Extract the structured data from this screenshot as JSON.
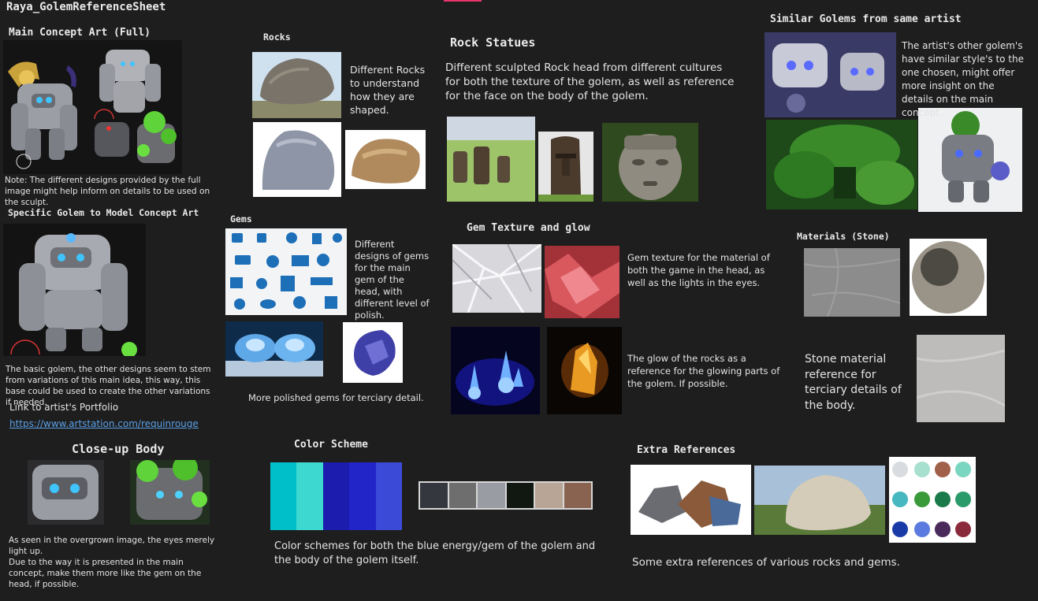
{
  "board_title": "Raya_GolemReferenceSheet",
  "main_concept": {
    "title": "Main Concept Art (Full)",
    "note": "Note: The different designs provided by the full image might help inform on details to be used on the sculpt."
  },
  "specific_golem": {
    "title": "Specific Golem to Model Concept Art",
    "desc": "The basic golem, the other designs seem to stem from variations of this main idea, this way, this base could be used to create the other variations if needed.",
    "link_label": "Link to artist's Portfolio",
    "link_url": "https://www.artstation.com/requinrouge"
  },
  "closeup": {
    "title": "Close-up Body",
    "desc": "As seen in the overgrown image, the eyes merely light up.\nDue to the way it is presented in the main concept, make them more like the gem on the head, if possible."
  },
  "rocks": {
    "title": "Rocks",
    "desc": "Different Rocks to understand how they are shaped."
  },
  "gems": {
    "title": "Gems",
    "desc": "Different designs of gems for the main gem of the head, with different level of polish.",
    "desc2": "More polished gems for terciary detail."
  },
  "rock_statues": {
    "title": "Rock Statues",
    "desc": "Different sculpted Rock head from different cultures for both the texture of the golem, as well as reference for the face on the body of the golem."
  },
  "gem_texture": {
    "title": "Gem Texture and glow",
    "desc": "Gem texture for the material of both the game in the head, as well as the lights in the eyes.",
    "desc2": "The glow of the rocks as a reference for the glowing parts of the golem. If possible."
  },
  "similar": {
    "title": "Similar Golems from same artist",
    "desc": "The artist's other golem's have similar style's to the one chosen, might offer more insight on the details on the main concept."
  },
  "materials": {
    "title": "Materials (Stone)",
    "desc": "Stone material reference for terciary details of the body."
  },
  "color_scheme": {
    "title": "Color Scheme",
    "desc": "Color schemes for both the blue energy/gem of the golem and the body of the golem itself.",
    "blue_palette": [
      "#00bfc9",
      "#3dd9d0",
      "#1c1caf",
      "#2226c8",
      "#3c4ad8"
    ],
    "body_palette": [
      "#34373e",
      "#6e6e6e",
      "#9a9ca4",
      "#111811",
      "#b8a596",
      "#8a6250"
    ]
  },
  "extra": {
    "title": "Extra References",
    "desc": "Some extra references of various rocks and gems."
  }
}
